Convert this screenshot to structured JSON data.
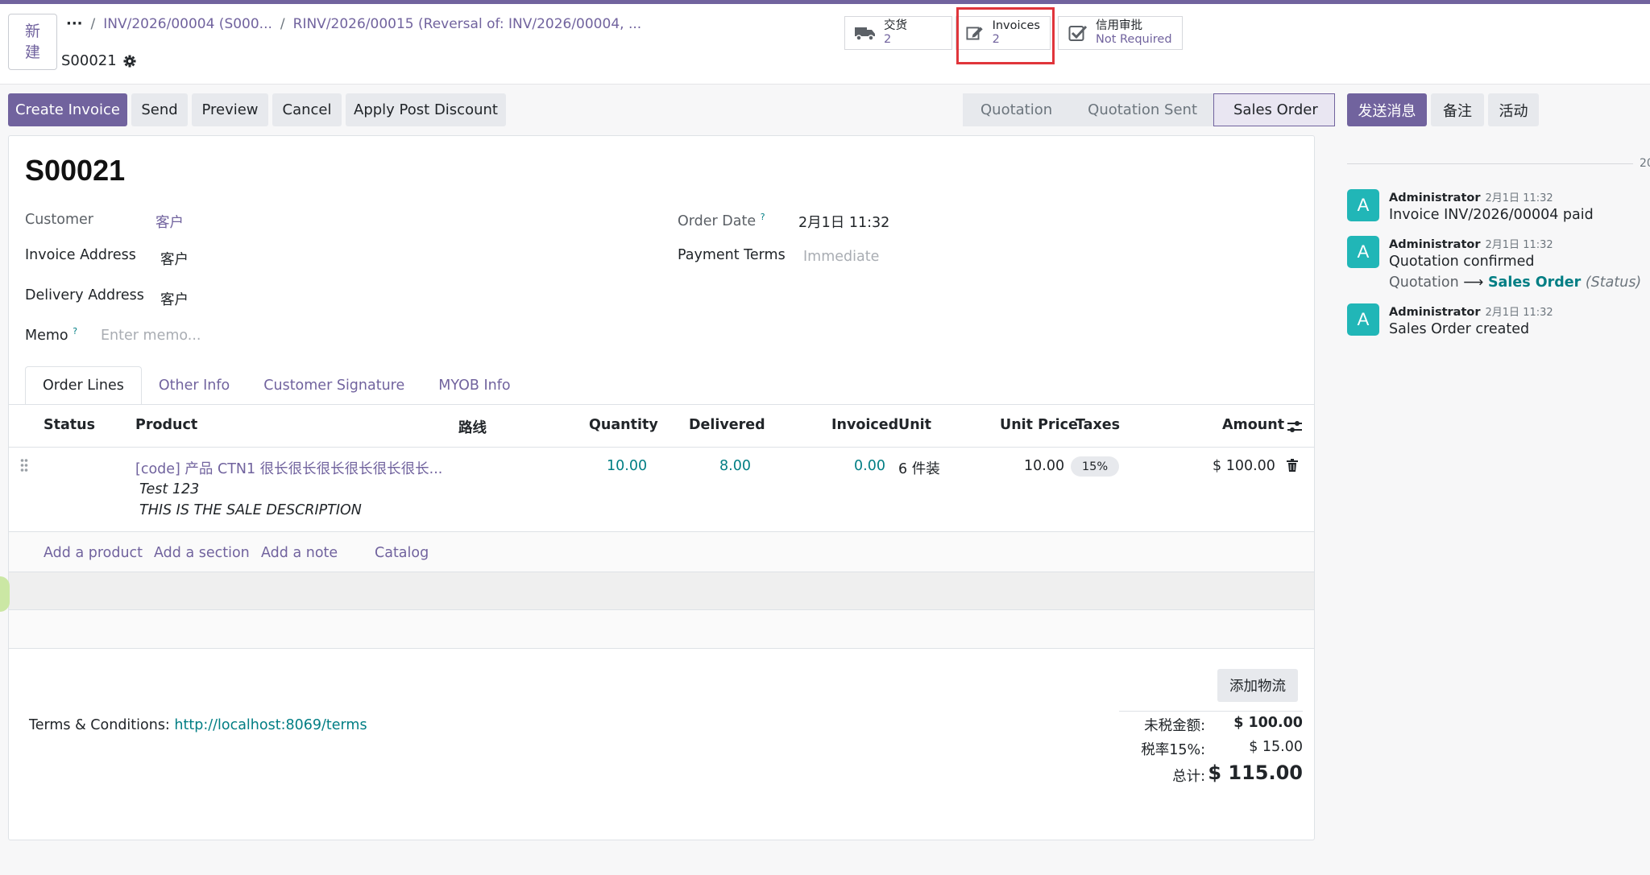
{
  "header": {
    "new_button": "新\n建",
    "breadcrumbs": [
      "INV/2026/00004 (S000...",
      "RINV/2026/00015 (Reversal of: INV/2026/00004, ..."
    ],
    "record_name": "S00021"
  },
  "smart_buttons": {
    "delivery": {
      "label": "交货",
      "value": "2"
    },
    "invoices": {
      "label": "Invoices",
      "value": "2"
    },
    "credit": {
      "label": "信用审批",
      "value": "Not Required"
    }
  },
  "actions": {
    "create_invoice": "Create Invoice",
    "send": "Send",
    "preview": "Preview",
    "cancel": "Cancel",
    "apply_discount": "Apply Post Discount"
  },
  "statusbar": [
    "Quotation",
    "Quotation Sent",
    "Sales Order"
  ],
  "form": {
    "title": "S00021",
    "customer_label": "Customer",
    "customer_value": "客户",
    "invoice_address_label": "Invoice Address",
    "invoice_address_value": "客户",
    "delivery_address_label": "Delivery Address",
    "delivery_address_value": "客户",
    "memo_label": "Memo",
    "memo_placeholder": "Enter memo...",
    "order_date_label": "Order Date",
    "order_date_value": "2月1日 11:32",
    "payment_terms_label": "Payment Terms",
    "payment_terms_placeholder": "Immediate",
    "help_mark": "?"
  },
  "tabs": [
    "Order Lines",
    "Other Info",
    "Customer Signature",
    "MYOB Info"
  ],
  "table": {
    "headers": {
      "status": "Status",
      "product": "Product",
      "route": "路线",
      "quantity": "Quantity",
      "delivered": "Delivered",
      "invoiced": "Invoiced",
      "unit": "Unit",
      "unit_price": "Unit Price",
      "taxes": "Taxes",
      "amount": "Amount"
    },
    "rows": [
      {
        "product": "[code] 产品 CTN1 很长很长很长很长很长很长...",
        "quantity": "10.00",
        "delivered": "8.00",
        "invoiced": "0.00",
        "unit": "6 件装",
        "unit_price": "10.00",
        "tax": "15%",
        "amount": "$ 100.00",
        "desc1": "Test 123",
        "desc2": "THIS IS THE SALE DESCRIPTION"
      }
    ],
    "add_links": {
      "product": "Add a product",
      "section": "Add a section",
      "note": "Add a note",
      "catalog": "Catalog"
    }
  },
  "footer": {
    "logistics_button": "添加物流",
    "terms_label": "Terms & Conditions: ",
    "terms_link": "http://localhost:8069/terms",
    "untaxed_label": "未税金额:",
    "untaxed_value": "$ 100.00",
    "tax_label": "税率15%:",
    "tax_value": "$ 15.00",
    "total_label": "总计:",
    "total_value": "$ 115.00"
  },
  "chatter": {
    "send_message": "发送消息",
    "log_note": "备注",
    "activity": "活动",
    "date_sep": "20",
    "messages": [
      {
        "avatar": "A",
        "author": "Administrator",
        "date": "2月1日 11:32",
        "body": "Invoice INV/2026/00004 paid"
      },
      {
        "avatar": "A",
        "author": "Administrator",
        "date": "2月1日 11:32",
        "body": "Quotation confirmed",
        "track_old": "Quotation",
        "track_arrow": "⟶",
        "track_new": "Sales Order",
        "track_field": "(Status)"
      },
      {
        "avatar": "A",
        "author": "Administrator",
        "date": "2月1日 11:32",
        "body": "Sales Order created"
      }
    ]
  },
  "colors": {
    "primary": "#71639e",
    "teal": "#017e84",
    "avatar": "#21b6b7",
    "highlight": "#e0353b"
  }
}
